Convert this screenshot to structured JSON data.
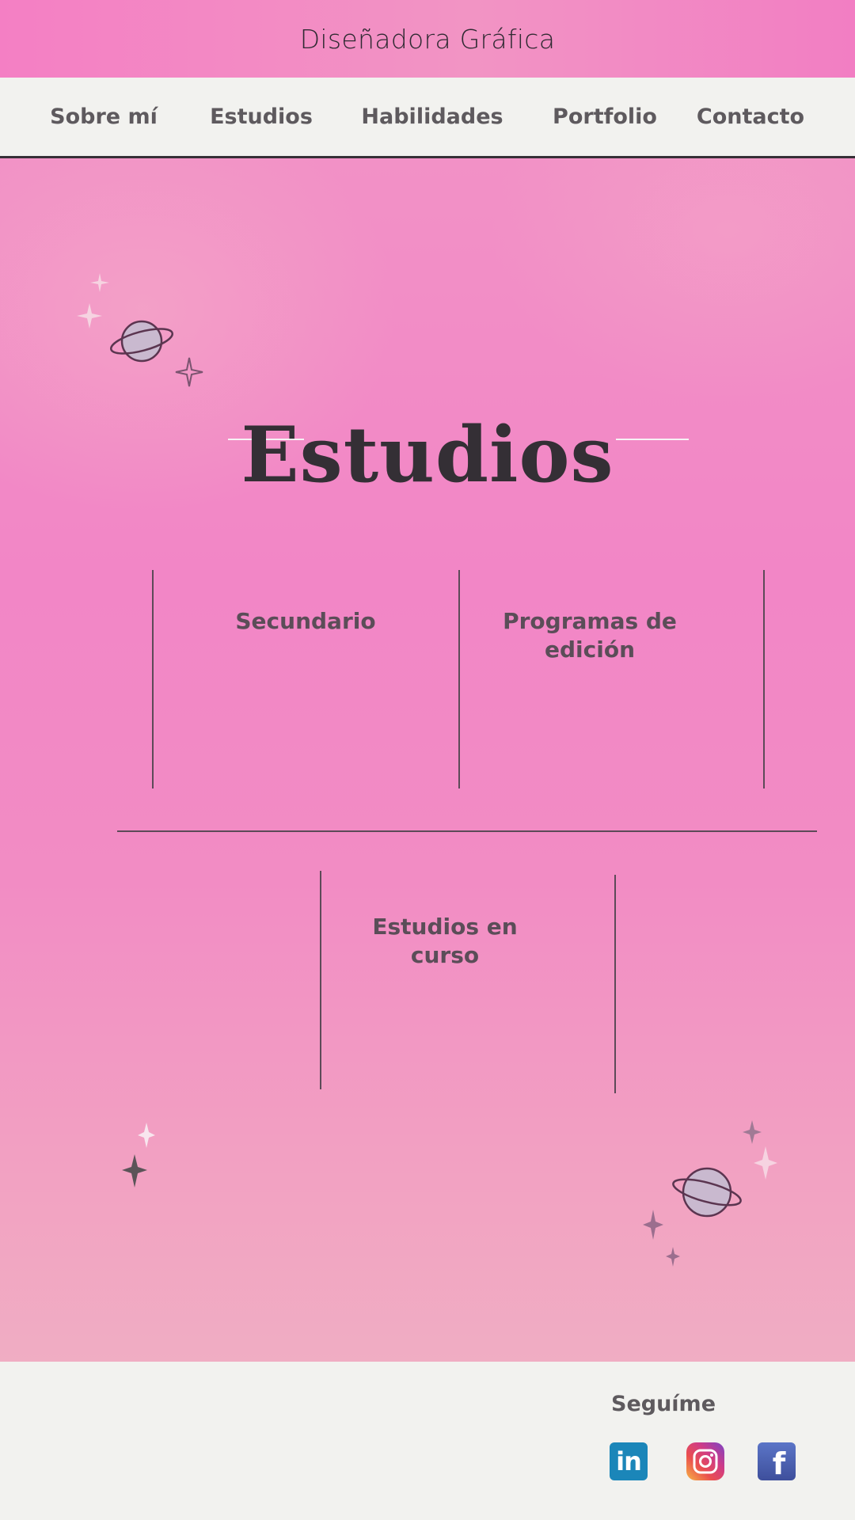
{
  "header": {
    "title": "Diseñadora Gráfica"
  },
  "nav": {
    "items": [
      {
        "label": "Sobre mí"
      },
      {
        "label": "Estudios"
      },
      {
        "label": "Habilidades"
      },
      {
        "label": "Portfolio"
      },
      {
        "label": "Contacto"
      }
    ]
  },
  "main": {
    "title": "Estudios",
    "cards": [
      {
        "title": "Secundario"
      },
      {
        "title": "Programas de edición"
      },
      {
        "title": "Estudios en curso"
      }
    ]
  },
  "footer": {
    "follow_label": "Seguíme",
    "social": [
      {
        "name": "linkedin-icon",
        "glyph": "in"
      },
      {
        "name": "instagram-icon"
      },
      {
        "name": "facebook-icon",
        "glyph": "f"
      }
    ]
  },
  "colors": {
    "pink_background": "#f28cc4",
    "dark_text": "#342f35",
    "nav_background": "#f2f2ef"
  }
}
